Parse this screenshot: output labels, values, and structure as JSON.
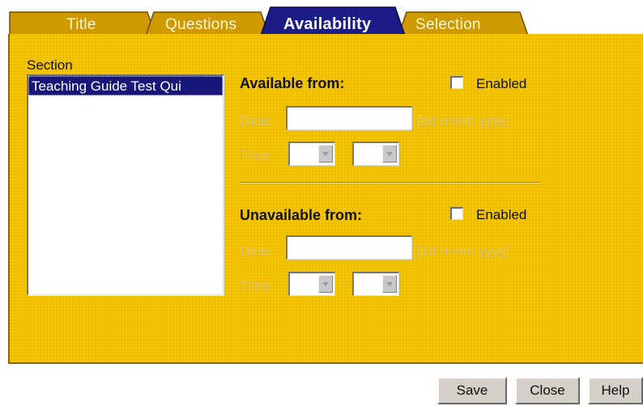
{
  "tabs": [
    {
      "label": "Title",
      "active": false
    },
    {
      "label": "Questions",
      "active": false
    },
    {
      "label": "Availability",
      "active": true
    },
    {
      "label": "Selection",
      "active": false
    }
  ],
  "section": {
    "label": "Section",
    "items": [
      "Teaching Guide Test Qui"
    ]
  },
  "available": {
    "heading": "Available from:",
    "enabled_label": "Enabled",
    "enabled": false,
    "date_label": "Date:",
    "date_value": "",
    "date_hint": "[dd mmm yyyy]",
    "time_label": "Time:",
    "time_sep": ":"
  },
  "unavailable": {
    "heading": "Unavailable from:",
    "enabled_label": "Enabled",
    "enabled": false,
    "date_label": "Date:",
    "date_value": "",
    "date_hint": "[dd mmm yyyy]",
    "time_label": "Time:",
    "time_sep": ":"
  },
  "buttons": {
    "save": "Save",
    "close": "Close",
    "help": "Help"
  },
  "colors": {
    "panel": "#f4c400",
    "tab_inactive": "#cf9a00",
    "tab_active": "#1c1c86",
    "selection": "#17177a"
  }
}
